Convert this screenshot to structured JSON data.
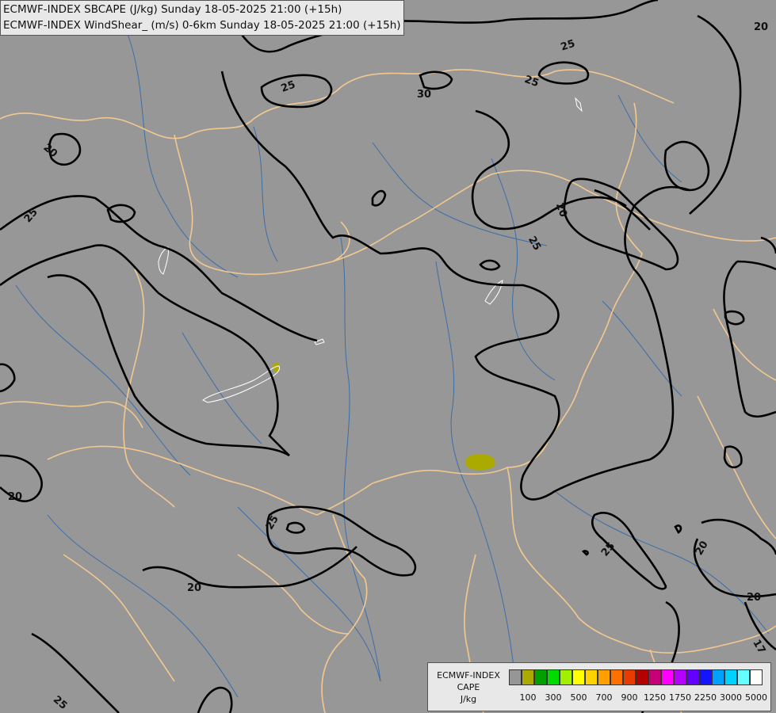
{
  "title": {
    "line1": "ECMWF-INDEX SBCAPE (J/kg) Sunday 18-05-2025 21:00 (+15h)",
    "line2": "ECMWF-INDEX WindShear_ (m/s) 0-6km Sunday 18-05-2025 21:00 (+15h)"
  },
  "contour_labels": [
    "25",
    "20",
    "25",
    "30",
    "25",
    "20",
    "25",
    "20",
    "25",
    "20",
    "25",
    "20",
    "20",
    "25",
    "20",
    "25",
    "17"
  ],
  "legend": {
    "line1": "ECMWF-INDEX",
    "line2": "CAPE",
    "line3": "J/kg",
    "ticks": [
      "100",
      "300",
      "500",
      "700",
      "900",
      "1250",
      "1750",
      "2250",
      "3000",
      "5000"
    ],
    "colors": [
      "#969696",
      "#aaaa00",
      "#00a000",
      "#00dc00",
      "#a0f000",
      "#ffff00",
      "#ffd200",
      "#ffa000",
      "#ff7000",
      "#e63c00",
      "#b40000",
      "#c80078",
      "#ff00ff",
      "#b400ff",
      "#6400ff",
      "#1414ff",
      "#00a0ff",
      "#00d2ff",
      "#64ffff",
      "#ffffff"
    ]
  },
  "colors": {
    "background": "#979797",
    "borders": "#f2c890",
    "rivers": "#3c6ea8",
    "contours": "#000000",
    "cape_100": "#aaaa00"
  }
}
